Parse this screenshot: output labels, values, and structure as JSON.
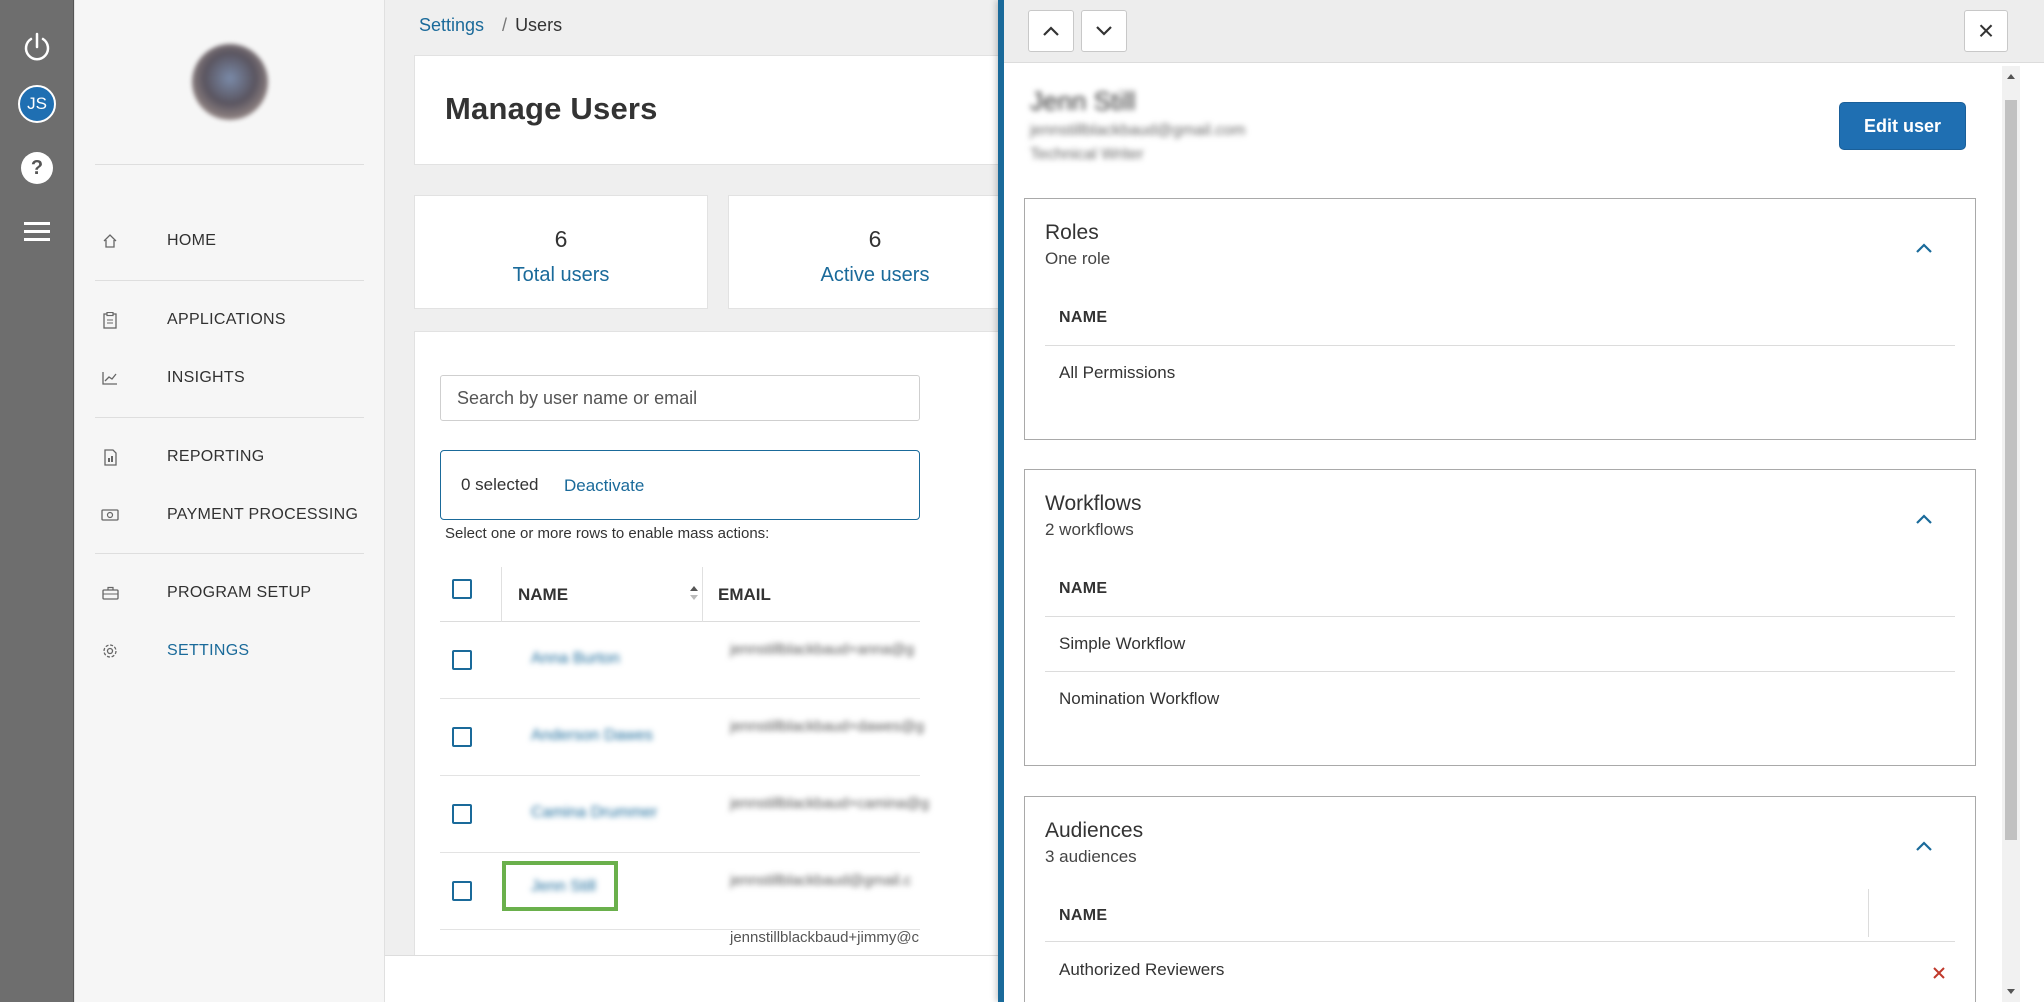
{
  "rail": {
    "avatar_initials": "JS",
    "help_glyph": "?"
  },
  "nav": {
    "items": [
      {
        "label": "HOME",
        "icon": "home-icon"
      },
      {
        "label": "APPLICATIONS",
        "icon": "clipboard-icon"
      },
      {
        "label": "INSIGHTS",
        "icon": "chart-icon"
      },
      {
        "label": "REPORTING",
        "icon": "report-icon"
      },
      {
        "label": "PAYMENT PROCESSING",
        "icon": "money-icon"
      },
      {
        "label": "PROGRAM SETUP",
        "icon": "toolbox-icon"
      },
      {
        "label": "SETTINGS",
        "icon": "gear-icon"
      }
    ]
  },
  "breadcrumb": {
    "parent": "Settings",
    "separator": "/",
    "current": "Users"
  },
  "page": {
    "title": "Manage Users"
  },
  "stats": [
    {
      "value": "6",
      "label": "Total users"
    },
    {
      "value": "6",
      "label": "Active users"
    }
  ],
  "search": {
    "placeholder": "Search by user name or email"
  },
  "bulk": {
    "selected": "0 selected",
    "action": "Deactivate",
    "hint": "Select one or more rows to enable mass actions:"
  },
  "table": {
    "headers": {
      "name": "NAME",
      "email": "EMAIL"
    },
    "rows": [
      {
        "name": "Anna Burton",
        "email": "jennstillblackbaud+anna@g"
      },
      {
        "name": "Anderson Dawes",
        "email": "jennstillblackbaud+dawes@g"
      },
      {
        "name": "Camina Drummer",
        "email": "jennstillblackbaud+camina@g"
      },
      {
        "name": "Jenn Still",
        "email": "jennstillblackbaud@gmail.c"
      },
      {
        "name": "",
        "email": "jennstillblackbaud+jimmy@c"
      }
    ]
  },
  "flyout": {
    "user": {
      "name": "Jenn Still",
      "email": "jennstillblackbaud@gmail.com",
      "title": "Technical Writer"
    },
    "edit_label": "Edit user",
    "close_glyph": "×",
    "sections": {
      "roles": {
        "title": "Roles",
        "subtitle": "One role",
        "header": "NAME",
        "items": [
          "All Permissions"
        ]
      },
      "workflows": {
        "title": "Workflows",
        "subtitle": "2 workflows",
        "header": "NAME",
        "items": [
          "Simple Workflow",
          "Nomination Workflow"
        ]
      },
      "audiences": {
        "title": "Audiences",
        "subtitle": "3 audiences",
        "header": "NAME",
        "items": [
          "Authorized Reviewers"
        ]
      }
    }
  },
  "colors": {
    "accent": "#1a6a9a",
    "button": "#1f6fb2",
    "highlight": "#6ab04c",
    "delete": "#c0392b"
  }
}
